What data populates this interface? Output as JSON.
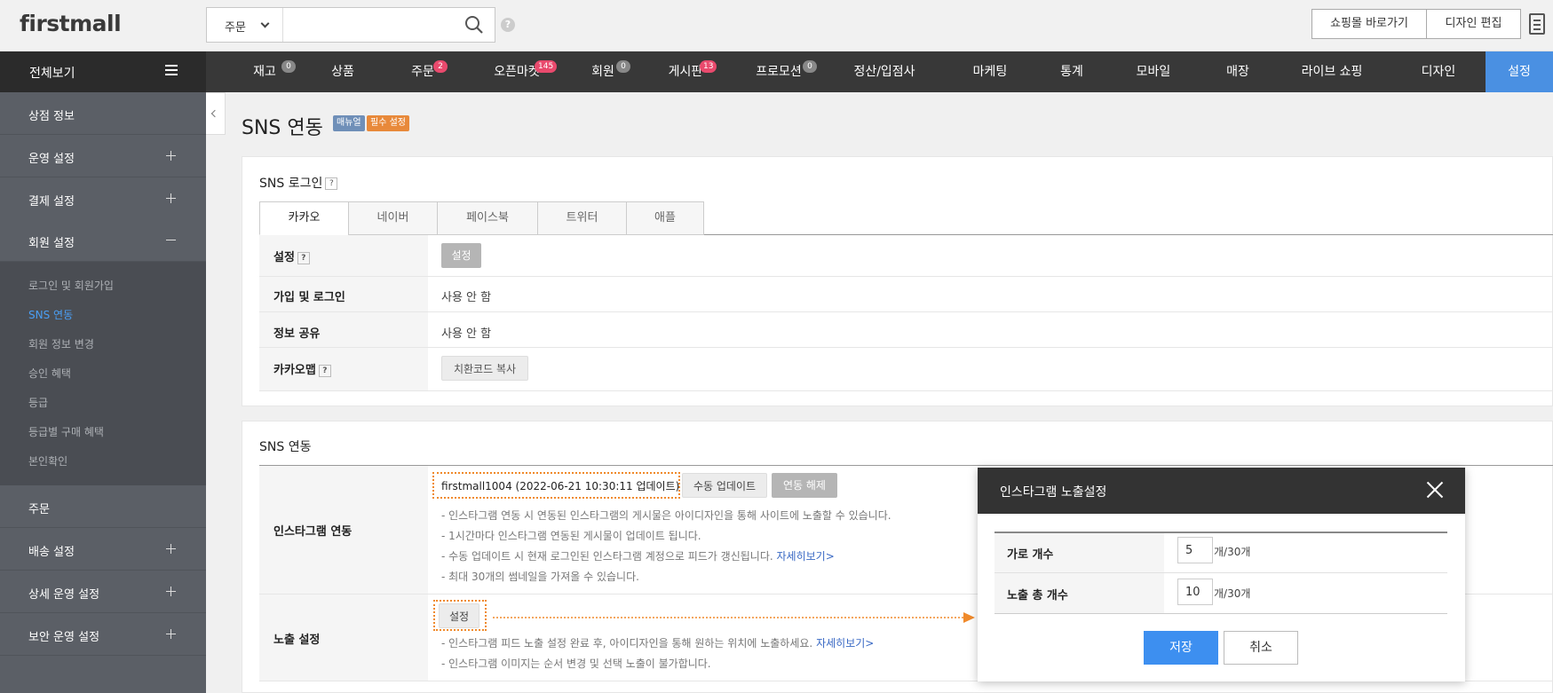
{
  "app": {
    "logo": "firstmall"
  },
  "search": {
    "type_label": "주문",
    "placeholder": ""
  },
  "header": {
    "shop_button": "쇼핑몰 바로가기",
    "design_button": "디자인 편집"
  },
  "nav": {
    "all_label": "전체보기",
    "items": [
      {
        "label": "재고",
        "badge": "0"
      },
      {
        "label": "상품",
        "badge": ""
      },
      {
        "label": "주문",
        "badge": "2"
      },
      {
        "label": "오픈마켓",
        "badge": "145"
      },
      {
        "label": "회원",
        "badge": "0"
      },
      {
        "label": "게시판",
        "badge": "13"
      },
      {
        "label": "프로모션",
        "badge": "0"
      },
      {
        "label": "정산/입점사",
        "badge": ""
      },
      {
        "label": "마케팅",
        "badge": ""
      },
      {
        "label": "통계",
        "badge": ""
      },
      {
        "label": "모바일",
        "badge": ""
      },
      {
        "label": "매장",
        "badge": ""
      },
      {
        "label": "라이브 쇼핑",
        "badge": ""
      },
      {
        "label": "디자인",
        "badge": ""
      },
      {
        "label": "설정",
        "badge": ""
      }
    ]
  },
  "sidebar": {
    "items": [
      "상점 정보",
      "운영 설정",
      "결제 설정",
      "회원 설정",
      "주문",
      "배송 설정",
      "상세 운영 설정",
      "보안 운영 설정"
    ],
    "sub_items": [
      "로그인 및 회원가입",
      "SNS 연동",
      "회원 정보 변경",
      "승인 혜택",
      "등급",
      "등급별 구매 혜택",
      "본인확인"
    ]
  },
  "page": {
    "title": "SNS 연동",
    "tag_manual": "매뉴얼",
    "tag_required": "필수 설정"
  },
  "sns_login": {
    "title": "SNS 로그인",
    "tabs": [
      "카카오",
      "네이버",
      "페이스북",
      "트위터",
      "애플"
    ],
    "rows": {
      "settings_label": "설정",
      "settings_button": "설정",
      "join_label": "가입 및 로그인",
      "join_value": "사용 안 함",
      "share_label": "정보 공유",
      "share_value": "사용 안 함",
      "kakao_label": "카카오맵",
      "kakao_button": "치환코드 복사"
    }
  },
  "sns_link": {
    "title": "SNS 연동",
    "instagram_label": "인스타그램 연동",
    "account_text": "firstmall1004 (2022-06-21 10:30:11 업데이트)",
    "manual_update_button": "수동 업데이트",
    "unlink_button": "연동 해제",
    "notes": [
      "- 인스타그램 연동 시 연동된 인스타그램의 게시물은 아이디자인을 통해 사이트에 노출할 수 있습니다.",
      "- 1시간마다 인스타그램 연동된 게시물이 업데이트 됩니다.",
      "- 수동 업데이트 시 현재 로그인된 인스타그램 계정으로 피드가 갱신됩니다.",
      "- 최대 30개의 썸네일을 가져올 수 있습니다."
    ],
    "more_link": "자세히보기>",
    "expose_label": "노출 설정",
    "expose_button": "설정",
    "expose_notes": [
      "- 인스타그램 피드 노출 설정 완료 후, 아이디자인을 통해 원하는 위치에 노출하세요.",
      "- 인스타그램 이미지는 순서 변경 및 선택 노출이 불가합니다."
    ],
    "expose_more_link": "자세히보기>"
  },
  "dialog": {
    "title": "인스타그램 노출설정",
    "rows": [
      {
        "label": "가로 개수",
        "value": "5",
        "suffix": "개/30개"
      },
      {
        "label": "노출 총 개수",
        "value": "10",
        "suffix": "개/30개"
      }
    ],
    "save_button": "저장",
    "cancel_button": "취소"
  },
  "colors": {
    "accent": "#4a90e2",
    "save": "#3d8ff0",
    "highlight": "#f08a2b",
    "badge_red": "#e94a6d"
  }
}
